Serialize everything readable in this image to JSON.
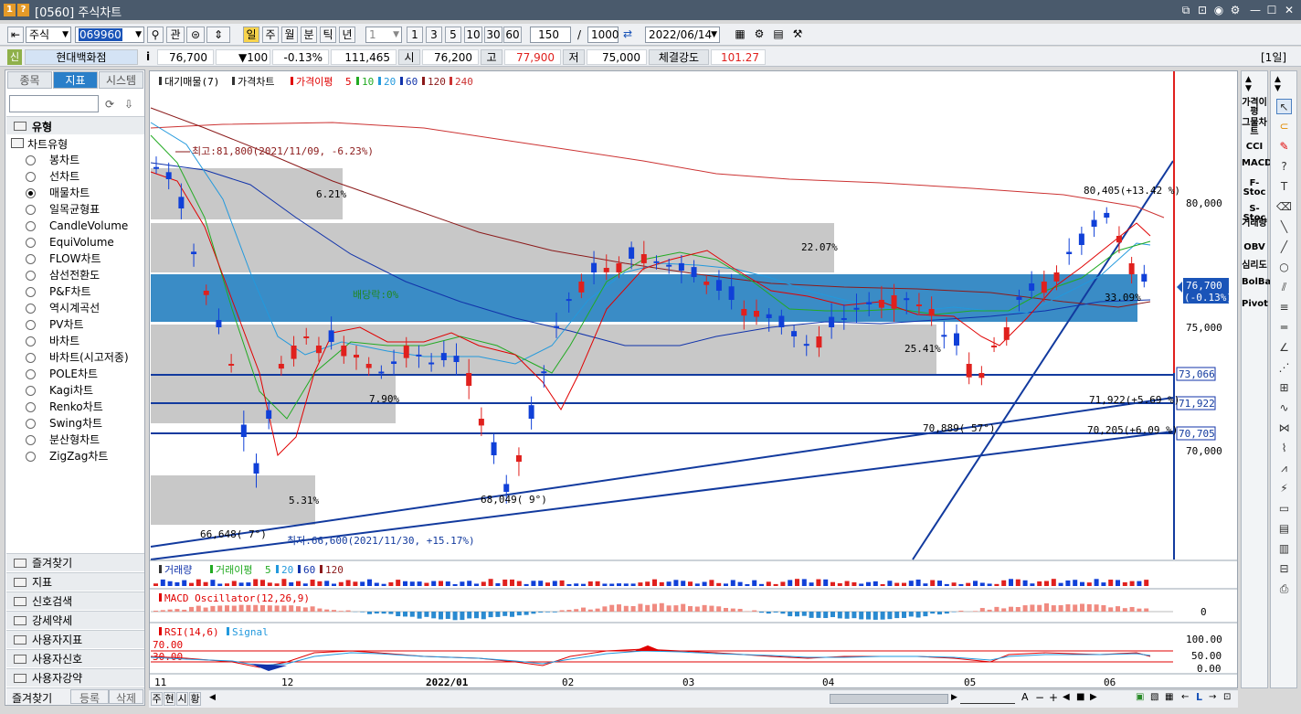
{
  "window": {
    "badge1": "1",
    "badge2": "?",
    "title": "[0560] 주식차트",
    "icons": [
      "restore-window-icon",
      "settings-icon",
      "minimize-icon",
      "maximize-icon",
      "close-icon"
    ]
  },
  "toolbar": {
    "market": "주식",
    "code": "069960",
    "btn_chart": "관",
    "periods": [
      "일",
      "주",
      "월",
      "분",
      "틱",
      "년"
    ],
    "interval_value": "1",
    "quick_periods": [
      "1",
      "3",
      "5",
      "10",
      "30",
      "60"
    ],
    "count_value": "150",
    "slash": "/",
    "total_value": "1000",
    "date_value": "2022/06/14"
  },
  "quote": {
    "type_badge": "신",
    "name": "현대백화점",
    "info_badge": "i",
    "price": "76,700",
    "change": "▼100",
    "change_pct": "-0.13%",
    "volume": "111,465",
    "open_label": "시",
    "open": "76,200",
    "high_label": "고",
    "high": "77,900",
    "low_label": "저",
    "low": "75,000",
    "strength_label": "체결강도",
    "strength": "101.27",
    "period_label": "[1일]"
  },
  "left_panel": {
    "tabs": [
      "종목",
      "지표",
      "시스템"
    ],
    "active_tab": "지표",
    "section_title": "유형",
    "group_title": "차트유형",
    "items": [
      "봉차트",
      "선차트",
      "매물차트",
      "일목균형표",
      "CandleVolume",
      "EquiVolume",
      "FLOW차트",
      "삼선전환도",
      "P&F차트",
      "역시계곡선",
      "PV차트",
      "바차트",
      "바차트(시고저종)",
      "POLE차트",
      "Kagi차트",
      "Renko차트",
      "Swing차트",
      "분산형차트",
      "ZigZag차트"
    ],
    "selected_item": "매물차트",
    "folders": [
      "즐겨찾기",
      "지표",
      "신호검색",
      "강세약세",
      "사용자지표",
      "사용자신호",
      "사용자강약"
    ],
    "footer": [
      "즐겨찾기",
      "등록",
      "삭제"
    ]
  },
  "price_pane": {
    "legend": {
      "supply": "대기매물(7)",
      "price": "가격차트",
      "ma_label": "가격이평",
      "ma_periods": [
        "5",
        "10",
        "20",
        "60",
        "120",
        "240"
      ]
    },
    "colors": {
      "ma5": "#e00000",
      "ma10": "#22aa22",
      "ma20": "#2299dd",
      "ma60": "#1133aa",
      "ma120": "#8b1a1a",
      "ma240": "#cc3333",
      "up": "#e0201d",
      "down": "#1040d8",
      "supply_bar": "#c8c8c8",
      "supply_highlight": "#3a8cc6",
      "trendline": "#123a9e"
    },
    "annotations": {
      "high": "최고:81,800(2021/11/09, -6.23%)",
      "low": "최저:66,600(2021/11/30, +15.17%)",
      "dividend": "배당락:0%",
      "pt1": "66,648(  7°)",
      "pt2": "68,049(  9°)",
      "pt3": "70,889( 57°)",
      "pt4": "70,205(+6.09 %)",
      "pt5": "71,922(+5.69 %)",
      "pt6": "80,405(+13.42 %)"
    },
    "supply_pcts": [
      "6.21%",
      "22.07%",
      "33.09%",
      "25.41%",
      "7.90%",
      "5.31%"
    ],
    "y_ticks": [
      "80,000",
      "75,000",
      "70,000"
    ],
    "y_axis_marks": [
      "73,066",
      "71,922",
      "70,705"
    ],
    "current_price_tag": "76,700",
    "current_change_tag": "(-0.13%)"
  },
  "volume_pane": {
    "title": "거래량",
    "ma_label": "거래이평",
    "ma_periods": [
      "5",
      "20",
      "60",
      "120"
    ]
  },
  "macd_pane": {
    "title": "MACD Oscillator(12,26,9)",
    "zero": "0"
  },
  "rsi_pane": {
    "title": "RSI(14,6)",
    "signal": "Signal",
    "upper": "70.00",
    "lower": "30.00",
    "ticks": [
      "100.00",
      "50.00",
      "0.00"
    ]
  },
  "x_axis": [
    "11",
    "12",
    "2022/01",
    "02",
    "03",
    "04",
    "05",
    "06"
  ],
  "bottom_tabs": [
    "주",
    "현",
    "시",
    "황"
  ],
  "right_bar": {
    "indicators": [
      "가격이평",
      "그물차트",
      "CCI",
      "MACD",
      "F-Stoc",
      "S-Stoc",
      "거래량",
      "OBV",
      "심리도",
      "BolBand",
      "Pivot"
    ]
  }
}
